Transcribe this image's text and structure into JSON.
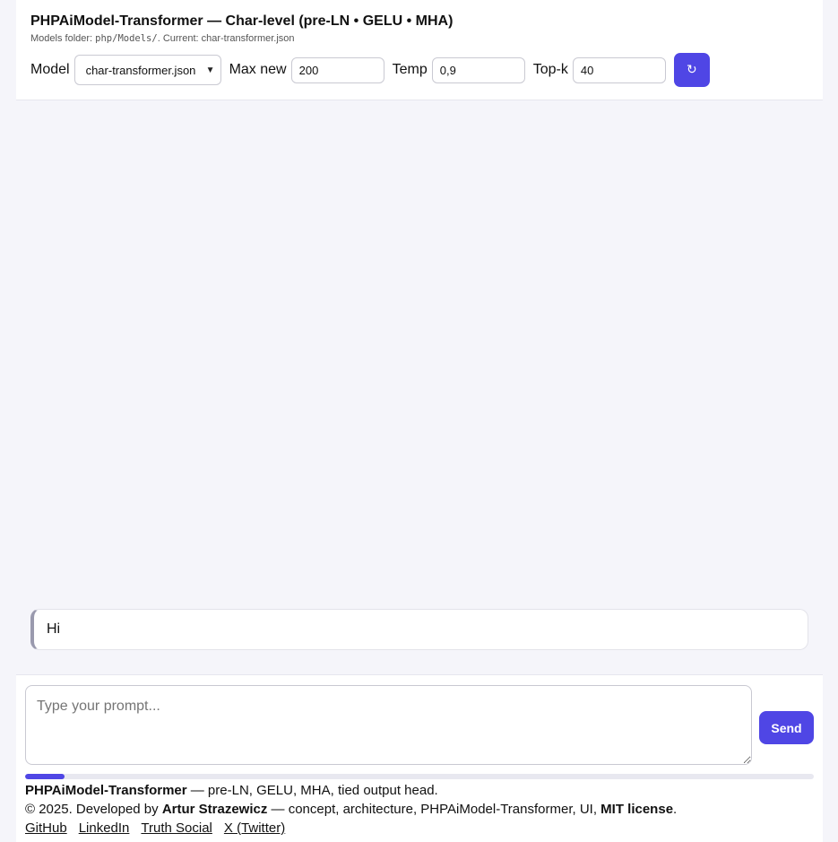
{
  "header": {
    "title": "PHPAiModel-Transformer — Char-level (pre-LN • GELU • MHA)",
    "subtitle_prefix": "Models folder: ",
    "subtitle_path": "php/Models/",
    "subtitle_suffix": ". Current: char-transformer.json"
  },
  "controls": {
    "model_label": "Model",
    "model_selected": "char-transformer.json",
    "max_new_label": "Max new",
    "max_new_value": "200",
    "temp_label": "Temp",
    "temp_value": "0,9",
    "topk_label": "Top-k",
    "topk_value": "40",
    "refresh_icon": "refresh-icon",
    "refresh_glyph": "↻"
  },
  "chat": {
    "messages": [
      {
        "role": "user",
        "text": "Hi"
      }
    ]
  },
  "composer": {
    "placeholder": "Type your prompt...",
    "value": "",
    "send_label": "Send",
    "progress": 0.05
  },
  "footer": {
    "project_name": "PHPAiModel-Transformer",
    "project_desc": " — pre-LN, GELU, MHA, tied output head.",
    "copyright_prefix": "© 2025. Developed by ",
    "author": "Artur Strazewicz",
    "copyright_mid": " — concept, architecture, PHPAiModel-Transformer, UI, ",
    "license": "MIT license",
    "copyright_end": ".",
    "links": [
      "GitHub",
      "LinkedIn",
      "Truth Social",
      "X (Twitter)"
    ]
  },
  "colors": {
    "accent": "#4f46e5",
    "background": "#f5f5fa",
    "panel": "#ffffff"
  }
}
